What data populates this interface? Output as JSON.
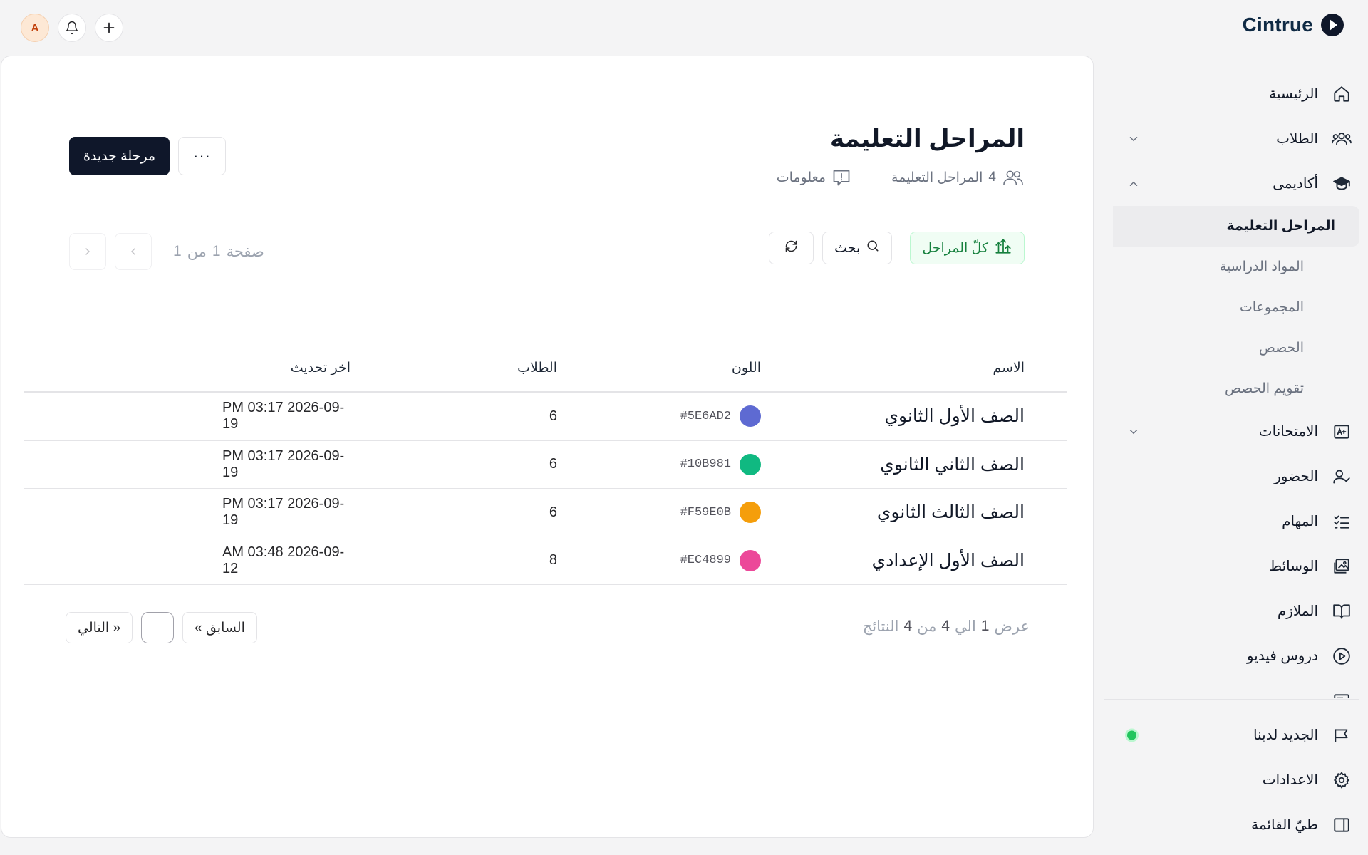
{
  "brand": {
    "name": "Cintrue"
  },
  "topbar": {
    "avatar_initial": "A"
  },
  "sidebar": {
    "items": [
      {
        "label": "الرئيسية",
        "icon": "home-icon"
      },
      {
        "label": "الطلاب",
        "icon": "users-icon"
      },
      {
        "label": "أكاديمى",
        "icon": "graduation-cap-icon"
      }
    ],
    "academic_sub": [
      {
        "label": "المراحل التعليمة",
        "active": true
      },
      {
        "label": "المواد الدراسية"
      },
      {
        "label": "المجموعات"
      },
      {
        "label": "الحصص"
      },
      {
        "label": "تقويم الحصص"
      }
    ],
    "items_after": [
      {
        "label": "الامتحانات",
        "icon": "exam-icon"
      },
      {
        "label": "الحضور",
        "icon": "attendance-icon"
      },
      {
        "label": "المهام",
        "icon": "tasks-icon"
      },
      {
        "label": "الوسائط",
        "icon": "media-icon"
      },
      {
        "label": "الملازم",
        "icon": "book-icon"
      },
      {
        "label": "دروس فيديو",
        "icon": "play-icon"
      }
    ],
    "bottom": [
      {
        "label": "الجديد لدينا",
        "icon": "megaphone-icon"
      },
      {
        "label": "الاعدادات",
        "icon": "gear-icon"
      },
      {
        "label": "طيّ القائمة",
        "icon": "sidebar-collapse-icon"
      }
    ]
  },
  "page": {
    "title": "المراحل التعليمة",
    "count": "4",
    "count_label": "المراحل التعليمة",
    "info_label": "معلومات",
    "new_button": "مرحلة جديدة",
    "more_button": "···"
  },
  "toolbar": {
    "filter_all": "كلّ المراحل",
    "search": "بحث"
  },
  "pager_top": {
    "page_word": "صفحة",
    "page": "1",
    "of_word": "من",
    "total": "1"
  },
  "table": {
    "headers": {
      "name": "الاسم",
      "color": "اللون",
      "students": "الطلاب",
      "updated": "اخر تحديث"
    },
    "rows": [
      {
        "name": "الصف الأول الثانوي",
        "color": "#5E6AD2",
        "students": "6",
        "updated": "PM 03:17 2026-09-19"
      },
      {
        "name": "الصف الثاني الثانوي",
        "color": "#10B981",
        "students": "6",
        "updated": "PM 03:17 2026-09-19"
      },
      {
        "name": "الصف الثالث الثانوي",
        "color": "#F59E0B",
        "students": "6",
        "updated": "PM 03:17 2026-09-19"
      },
      {
        "name": "الصف الأول الإعدادي",
        "color": "#EC4899",
        "students": "8",
        "updated": "AM 03:48 2026-09-12"
      }
    ]
  },
  "footer": {
    "showing": "عرض",
    "from": "1",
    "to_word": "الي",
    "to": "4",
    "of_word": "من",
    "total": "4",
    "results": "النتائج",
    "prev": "« السابق",
    "next": "التالي »"
  }
}
